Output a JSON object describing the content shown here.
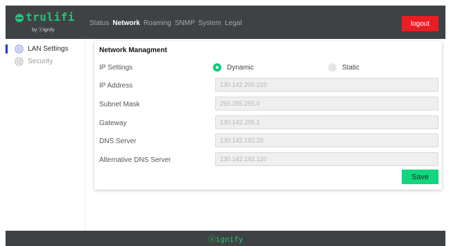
{
  "brand": {
    "logo_text": "trulifi",
    "logo_sub": "by ⓢignify",
    "accent": "#22c57a"
  },
  "nav": {
    "items": [
      {
        "label": "Status",
        "active": false
      },
      {
        "label": "Network",
        "active": true
      },
      {
        "label": "Roaming",
        "active": false
      },
      {
        "label": "SNMP",
        "active": false
      },
      {
        "label": "System",
        "active": false
      },
      {
        "label": "Legal",
        "active": false
      }
    ],
    "logout_label": "logout"
  },
  "sidebar": {
    "items": [
      {
        "label": "LAN Settings",
        "icon": "gear-icon",
        "active": true
      },
      {
        "label": "Security",
        "icon": "shield-icon",
        "active": false
      }
    ]
  },
  "card": {
    "title": "Network Managment",
    "ip_settings": {
      "label": "IP Settings",
      "options": [
        {
          "label": "Dynamic",
          "selected": true
        },
        {
          "label": "Static",
          "selected": false
        }
      ]
    },
    "fields": [
      {
        "label": "IP Address",
        "value": "130.142.205.210"
      },
      {
        "label": "Subnet Mask",
        "value": "255.255.255.0"
      },
      {
        "label": "Gateway",
        "value": "130.142.205.1"
      },
      {
        "label": "DNS Server",
        "value": "130.142.192.20"
      },
      {
        "label": "Alternative DNS Server",
        "value": "130.142.192.120"
      }
    ],
    "save_label": "Save"
  },
  "footer": {
    "brand": "ⓢignify"
  },
  "colors": {
    "topbar": "#3f4244",
    "logout": "#ec1c24",
    "save": "#10d77d",
    "radio_on": "#10c978",
    "sidebar_indicator": "#1c32d6"
  }
}
